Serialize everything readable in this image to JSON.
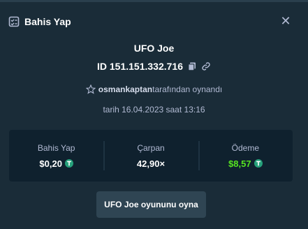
{
  "modal": {
    "title": "Bahis Yap",
    "close_icon": "close-icon"
  },
  "game": {
    "name": "UFO Joe",
    "bet_id": "ID 151.151.332.716",
    "player": "osmankaptan",
    "played_by_suffix": "tarafından oynandı",
    "date_text": "tarih 16.04.2023 saat 13:16"
  },
  "stats": {
    "bet": {
      "label": "Bahis Yap",
      "value": "$0,20"
    },
    "multiplier": {
      "label": "Çarpan",
      "value": "42,90×"
    },
    "payout": {
      "label": "Ödeme",
      "value": "$8,57"
    }
  },
  "play_button": "UFO Joe oyununu oyna",
  "colors": {
    "background": "#1a2c38",
    "panel": "#0f212e",
    "button": "#2f4553",
    "payout_green": "#56e321",
    "coin_green": "#26a17b",
    "muted_text": "#b1bad3"
  }
}
